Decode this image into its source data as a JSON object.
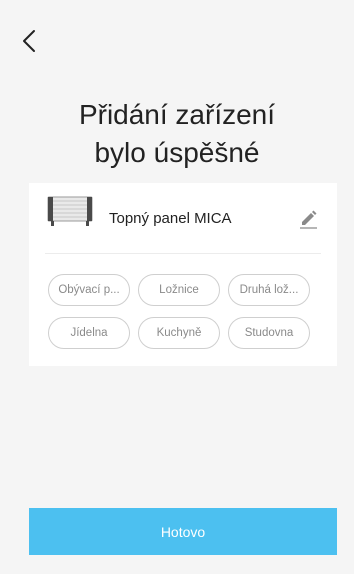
{
  "header": {
    "back_icon": "chevron-left-icon",
    "title_line1": "Přidání zařízení",
    "title_line2": "bylo úspěšné"
  },
  "device": {
    "name": "Topný panel MICA",
    "image_icon": "heating-panel-image",
    "edit_icon": "pencil-icon"
  },
  "rooms": [
    {
      "label": "Obývací p..."
    },
    {
      "label": "Ložnice"
    },
    {
      "label": "Druhá lož..."
    },
    {
      "label": "Jídelna"
    },
    {
      "label": "Kuchyně"
    },
    {
      "label": "Studovna"
    }
  ],
  "footer": {
    "done_label": "Hotovo"
  },
  "colors": {
    "accent": "#4cc0f0",
    "background": "#f5f5f5",
    "card": "#ffffff"
  }
}
